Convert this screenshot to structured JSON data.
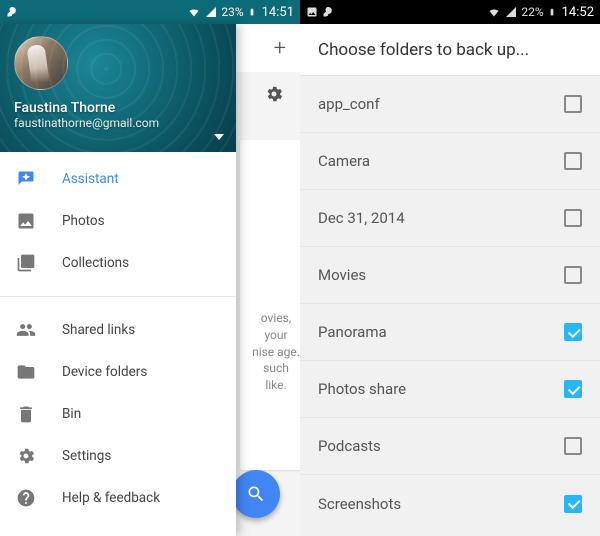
{
  "left": {
    "statusbar": {
      "battery": "23%",
      "time": "14:51"
    },
    "account": {
      "name": "Faustina Thorne",
      "email": "faustinathorne@gmail.com"
    },
    "drawer_items": [
      {
        "label": "Assistant",
        "icon": "assistant-icon",
        "active": true
      },
      {
        "label": "Photos",
        "icon": "photos-icon",
        "active": false
      },
      {
        "label": "Collections",
        "icon": "collections-icon",
        "active": false
      }
    ],
    "drawer_items2": [
      {
        "label": "Shared links",
        "icon": "people-icon"
      },
      {
        "label": "Device folders",
        "icon": "folder-icon"
      },
      {
        "label": "Bin",
        "icon": "trash-icon"
      },
      {
        "label": "Settings",
        "icon": "gear-icon"
      },
      {
        "label": "Help & feedback",
        "icon": "help-icon"
      }
    ],
    "bg_text": "ovies,\nyour\nnise\nage.\n\nsuch\nlike."
  },
  "right": {
    "statusbar": {
      "battery": "22%",
      "time": "14:52"
    },
    "title": "Choose folders to back up...",
    "folders": [
      {
        "name": "app_conf",
        "checked": false
      },
      {
        "name": "Camera",
        "checked": false
      },
      {
        "name": "Dec 31, 2014",
        "checked": false
      },
      {
        "name": "Movies",
        "checked": false
      },
      {
        "name": "Panorama",
        "checked": true
      },
      {
        "name": "Photos share",
        "checked": true
      },
      {
        "name": "Podcasts",
        "checked": false
      },
      {
        "name": "Screenshots",
        "checked": true
      }
    ]
  }
}
